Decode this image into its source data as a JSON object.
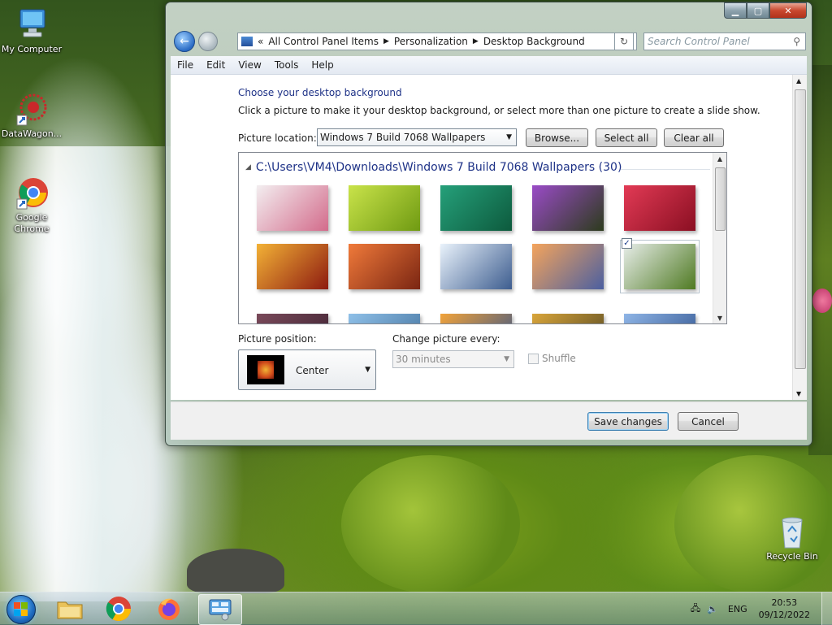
{
  "desktop": {
    "icons": [
      {
        "label": "My Computer"
      },
      {
        "label": "DataWagon..."
      },
      {
        "label": "Google Chrome"
      },
      {
        "label": "Recycle Bin"
      }
    ]
  },
  "window": {
    "address": {
      "overflow": "«",
      "segments": [
        "All Control Panel Items",
        "Personalization",
        "Desktop Background"
      ]
    },
    "search_placeholder": "Search Control Panel",
    "menu": [
      "File",
      "Edit",
      "View",
      "Tools",
      "Help"
    ],
    "heading": "Choose your desktop background",
    "description": "Click a picture to make it your desktop background, or select more than one picture to create a slide show.",
    "picture_location_label": "Picture location:",
    "picture_location_value": "Windows 7 Build 7068 Wallpapers",
    "browse_label": "Browse...",
    "select_all_label": "Select all",
    "clear_all_label": "Clear all",
    "group_title": "C:\\Users\\VM4\\Downloads\\Windows 7 Build 7068 Wallpapers (30)",
    "thumbnails": [
      {
        "name": "white-flower",
        "colors": [
          "#f3eef0",
          "#d36b8b"
        ]
      },
      {
        "name": "green-succulent",
        "colors": [
          "#c9e34a",
          "#6f9a12"
        ]
      },
      {
        "name": "green-leaves",
        "colors": [
          "#25a07a",
          "#0d5a3d"
        ]
      },
      {
        "name": "purple-thistle",
        "colors": [
          "#9a4bc7",
          "#2c3b1c"
        ]
      },
      {
        "name": "red-dahlia",
        "colors": [
          "#e23a55",
          "#8a0f22"
        ]
      },
      {
        "name": "autumn-leaves",
        "colors": [
          "#f3b236",
          "#8d1a10"
        ]
      },
      {
        "name": "red-canyon",
        "colors": [
          "#f07a3a",
          "#7a2512"
        ]
      },
      {
        "name": "ice-lake",
        "colors": [
          "#e9f2fb",
          "#3d5d8f"
        ]
      },
      {
        "name": "sunset-coast",
        "colors": [
          "#f4a45c",
          "#4b5fa0"
        ]
      },
      {
        "name": "waterfall",
        "colors": [
          "#e7ede9",
          "#4f7a22"
        ],
        "selected": true
      },
      {
        "name": "partial-1",
        "colors": [
          "#7a4a5a",
          "#3b2030"
        ]
      },
      {
        "name": "partial-2",
        "colors": [
          "#8fc0e8",
          "#3f6e9a"
        ]
      },
      {
        "name": "partial-3",
        "colors": [
          "#f2a33a",
          "#2c4f8c"
        ]
      },
      {
        "name": "partial-4",
        "colors": [
          "#d9a53a",
          "#4e4422"
        ]
      },
      {
        "name": "partial-5",
        "colors": [
          "#8fb5e6",
          "#2b4e8a"
        ]
      }
    ],
    "picture_position_label": "Picture position:",
    "picture_position_value": "Center",
    "change_picture_label": "Change picture every:",
    "change_picture_value": "30 minutes",
    "shuffle_label": "Shuffle",
    "save_label": "Save changes",
    "cancel_label": "Cancel"
  },
  "taskbar": {
    "language": "ENG",
    "time": "20:53",
    "date": "09/12/2022"
  }
}
